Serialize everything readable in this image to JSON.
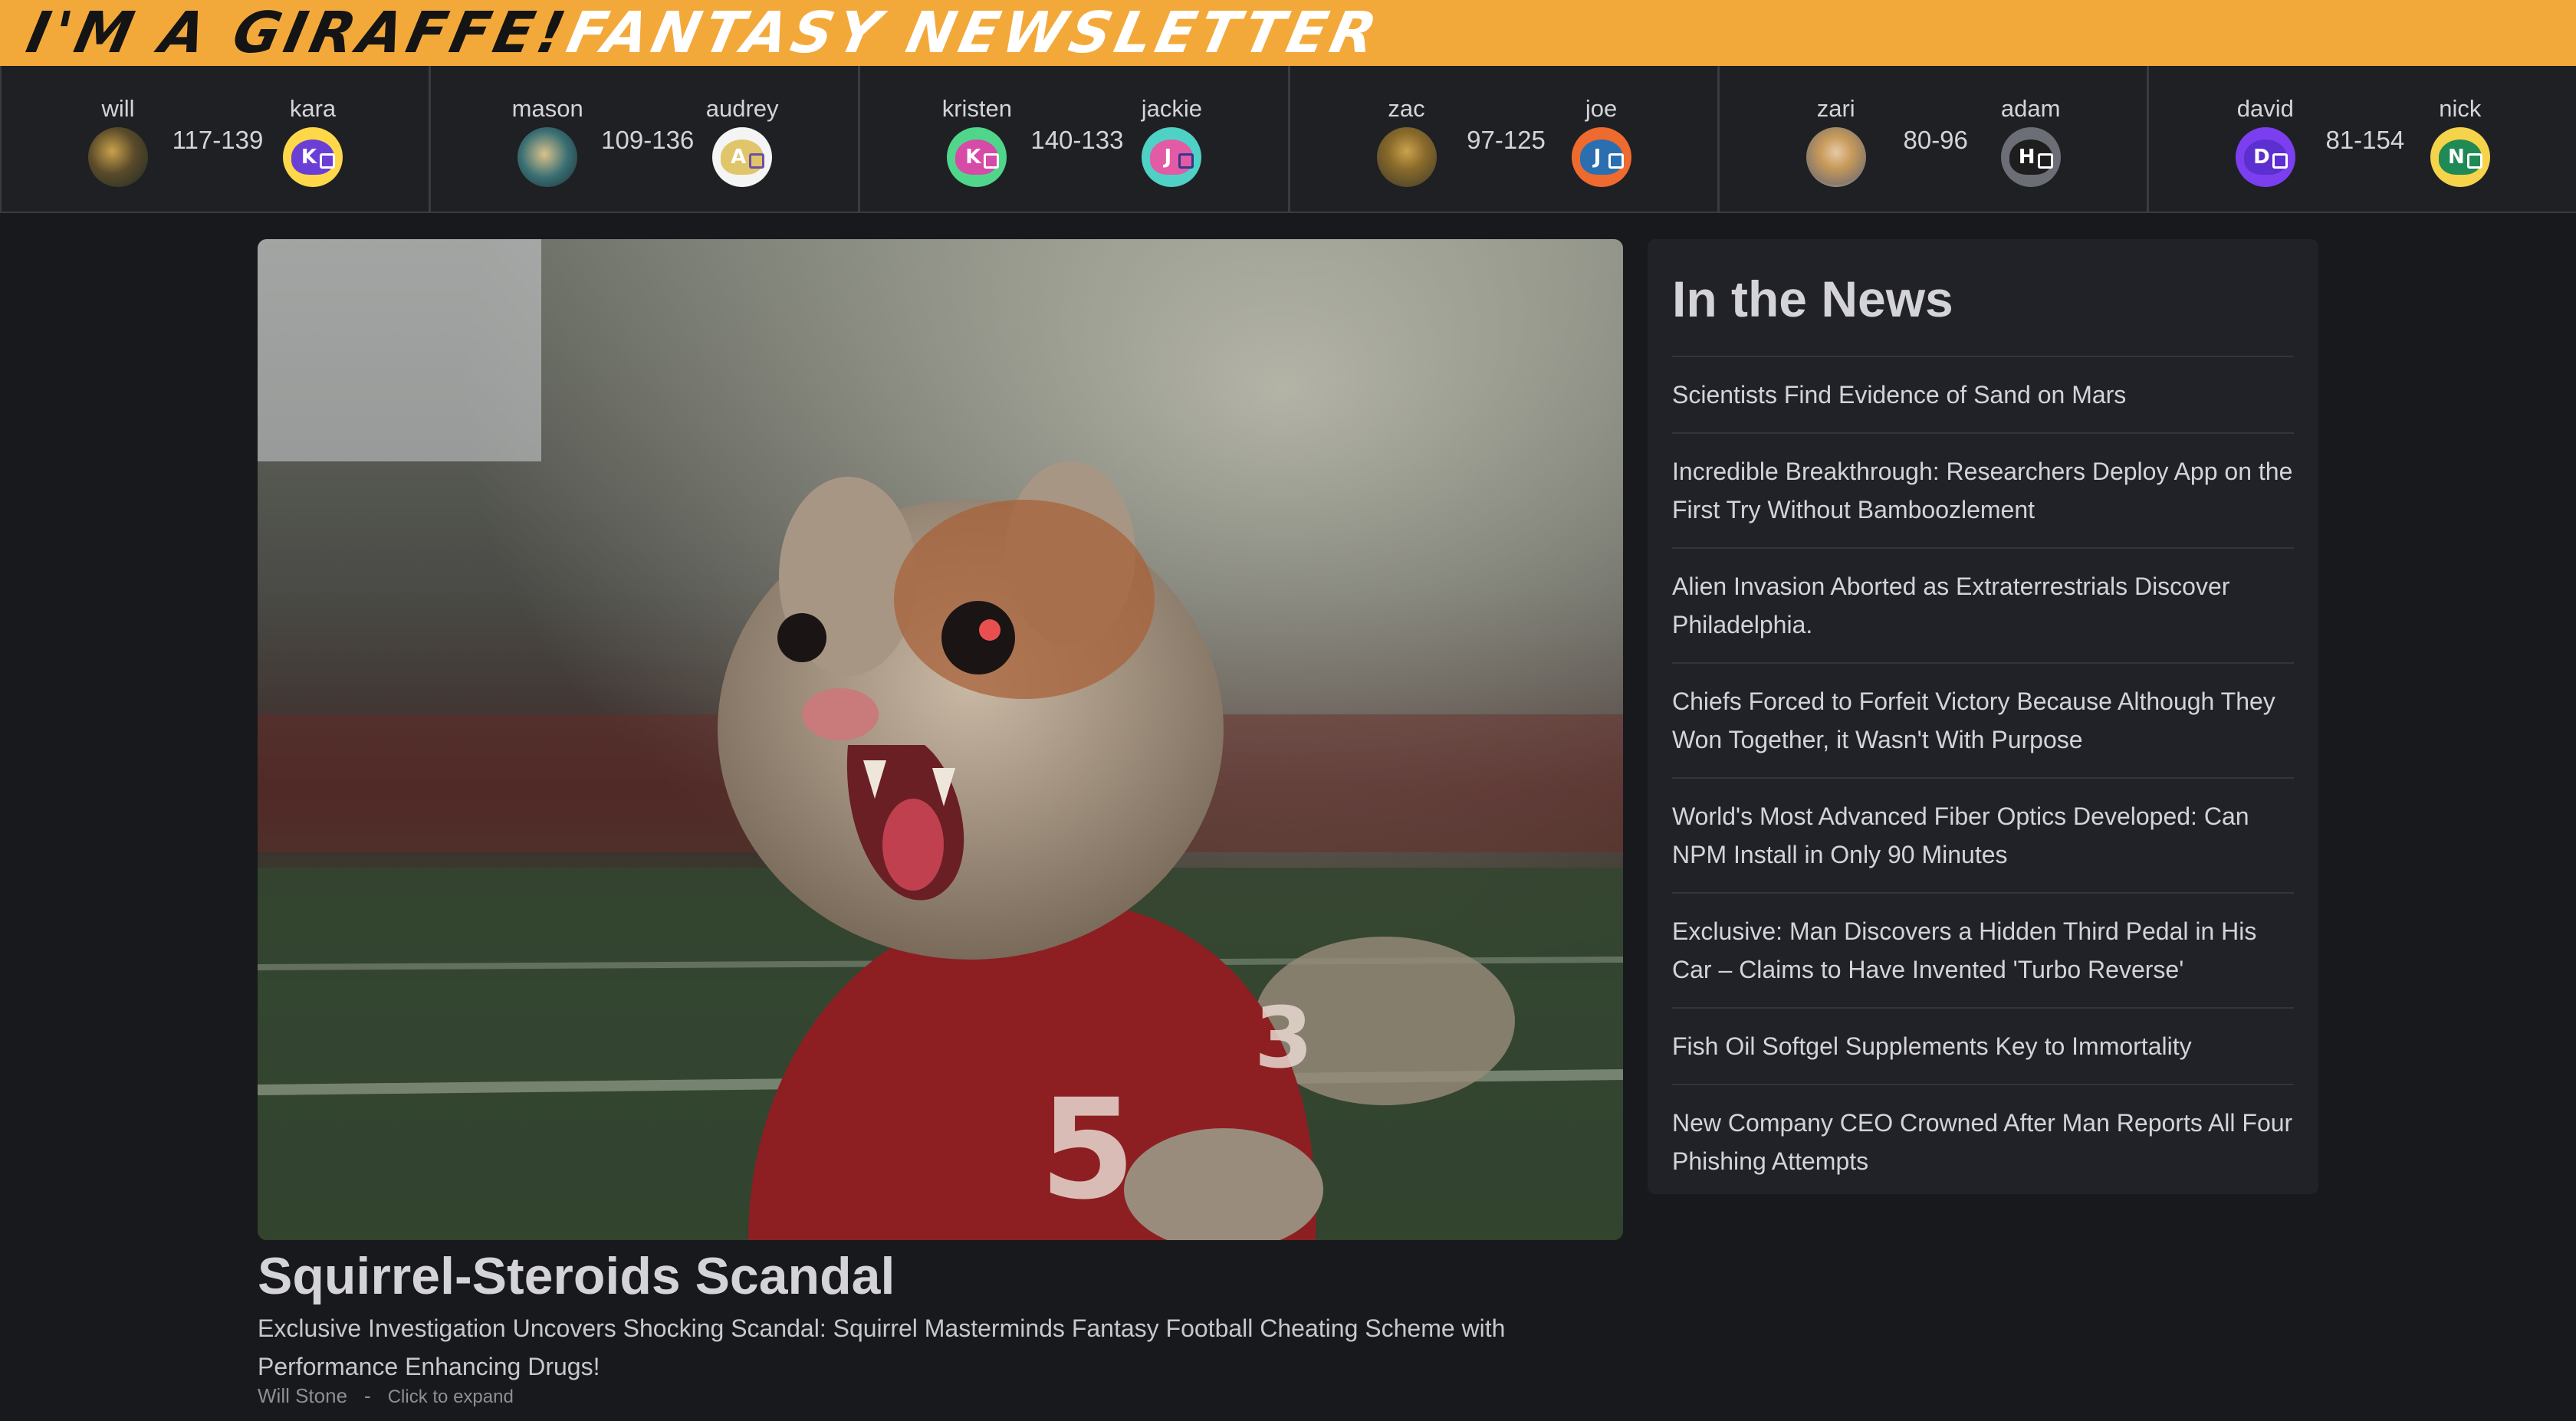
{
  "banner": {
    "title_part1": "I'M A GIRAFFE!",
    "title_part2": "FANTASY NEWSLETTER"
  },
  "matchups": [
    {
      "left": {
        "name": "will",
        "avatar": "photo"
      },
      "score": "117-139",
      "right": {
        "name": "kara",
        "letter": "K",
        "color": "#6b3fd6"
      }
    },
    {
      "left": {
        "name": "mason",
        "avatar": "photo"
      },
      "score": "109-136",
      "right": {
        "name": "audrey",
        "letter": "A",
        "color": "#e0c56a"
      }
    },
    {
      "left": {
        "name": "kristen",
        "letter": "K",
        "color": "#d64aa8"
      },
      "score": "140-133",
      "right": {
        "name": "jackie",
        "letter": "J",
        "color": "#e35aa5"
      }
    },
    {
      "left": {
        "name": "zac",
        "avatar": "photo"
      },
      "score": "97-125",
      "right": {
        "name": "joe",
        "letter": "J",
        "color": "#2b6fb0"
      }
    },
    {
      "left": {
        "name": "zari",
        "avatar": "photo"
      },
      "score": "80-96",
      "right": {
        "name": "adam",
        "letter": "H",
        "color": "#1e1e1e"
      }
    },
    {
      "left": {
        "name": "david",
        "letter": "D",
        "color": "#6b3fd6"
      },
      "score": "81-154",
      "right": {
        "name": "nick",
        "letter": "N",
        "color": "#1f8a55"
      }
    }
  ],
  "article": {
    "title": "Squirrel-Steroids Scandal",
    "subtitle": "Exclusive Investigation Uncovers Shocking Scandal: Squirrel Masterminds Fantasy Football Cheating Scheme with Performance Enhancing Drugs!",
    "author": "Will Stone",
    "separator": "-",
    "expand_label": "Click to expand"
  },
  "news": {
    "heading": "In the News",
    "items": [
      "Scientists Find Evidence of Sand on Mars",
      "Incredible Breakthrough: Researchers Deploy App on the First Try Without Bamboozlement",
      "Alien Invasion Aborted as Extraterrestrials Discover Philadelphia.",
      "Chiefs Forced to Forfeit Victory Because Although They Won Together, it Wasn't With Purpose",
      "World's Most Advanced Fiber Optics Developed: Can NPM Install in Only 90 Minutes",
      "Exclusive: Man Discovers a Hidden Third Pedal in His Car – Claims to Have Invented 'Turbo Reverse'",
      "Fish Oil Softgel Supplements Key to Immortality",
      "New Company CEO Crowned After Man Reports All Four Phishing Attempts"
    ]
  }
}
